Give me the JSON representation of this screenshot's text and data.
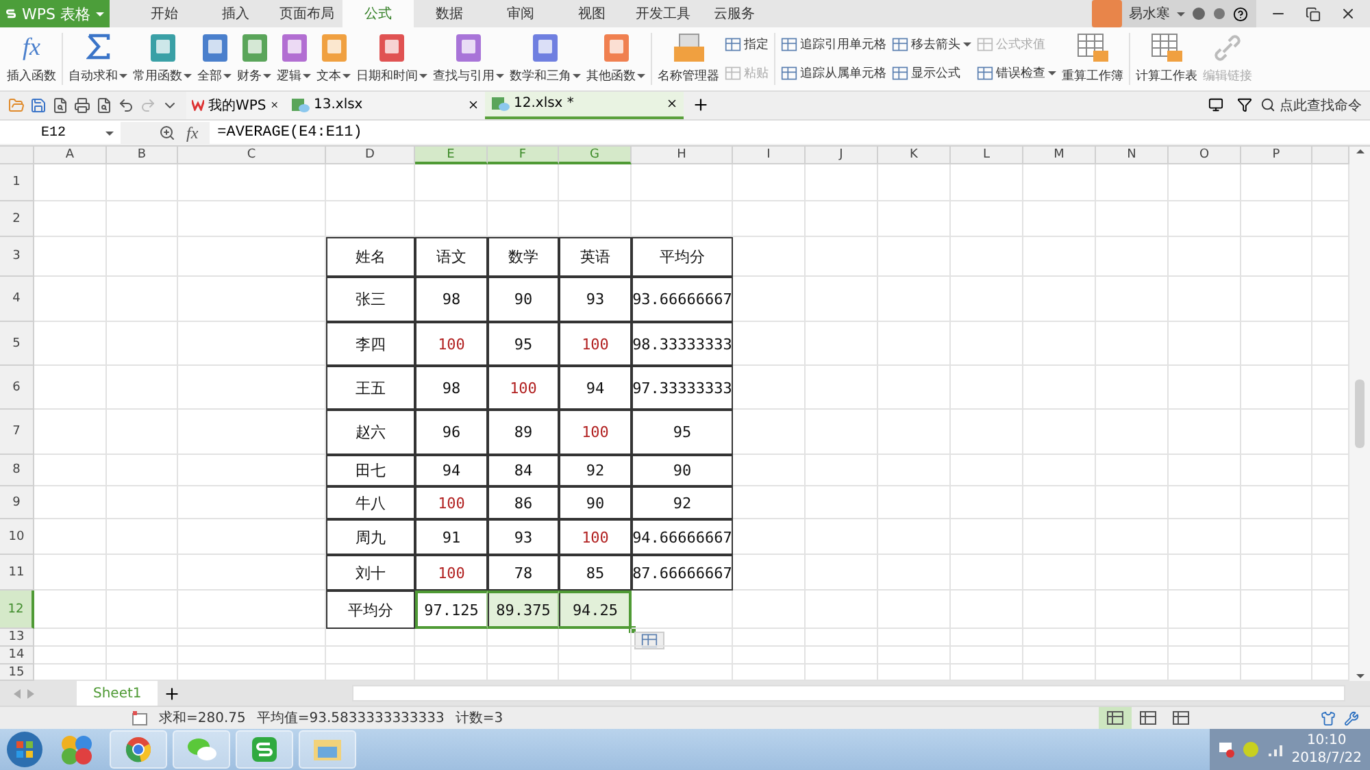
{
  "app_menu": {
    "label": "WPS 表格"
  },
  "menu_tabs": [
    {
      "label": "开始",
      "selected": false
    },
    {
      "label": "插入",
      "selected": false
    },
    {
      "label": "页面布局",
      "selected": false
    },
    {
      "label": "公式",
      "selected": true
    },
    {
      "label": "数据",
      "selected": false
    },
    {
      "label": "审阅",
      "selected": false
    },
    {
      "label": "视图",
      "selected": false
    },
    {
      "label": "开发工具",
      "selected": false
    },
    {
      "label": "云服务",
      "selected": false
    }
  ],
  "user": {
    "name": "易水寒"
  },
  "ribbon": [
    {
      "kind": "fx",
      "icon_text": "fx",
      "label": "插入函数",
      "dropdown": false,
      "disabled": false
    },
    {
      "kind": "sum",
      "label": "自动求和",
      "dropdown": true,
      "disabled": false
    },
    {
      "kind": "book",
      "label": "常用函数",
      "color": "#3aa0a6",
      "dropdown": true,
      "disabled": false
    },
    {
      "kind": "book",
      "label": "全部",
      "color": "#4a7fcc",
      "dropdown": true,
      "disabled": false
    },
    {
      "kind": "book",
      "label": "财务",
      "color": "#5aa55a",
      "dropdown": true,
      "disabled": false
    },
    {
      "kind": "book",
      "label": "逻辑",
      "color": "#b26ed2",
      "dropdown": true,
      "disabled": false
    },
    {
      "kind": "book",
      "label": "文本",
      "color": "#f0a040",
      "dropdown": true,
      "disabled": false
    },
    {
      "kind": "book",
      "label": "日期和时间",
      "color": "#e05252",
      "dropdown": true,
      "disabled": false
    },
    {
      "kind": "book",
      "label": "查找与引用",
      "color": "#a874d8",
      "dropdown": true,
      "disabled": false
    },
    {
      "kind": "book",
      "label": "数学和三角",
      "color": "#6f7fe0",
      "dropdown": true,
      "disabled": false
    },
    {
      "kind": "book",
      "label": "其他函数",
      "color": "#f08050",
      "dropdown": true,
      "disabled": false
    },
    {
      "kind": "manager",
      "label": "名称管理器",
      "dropdown": false,
      "disabled": false
    },
    {
      "kind": "stack",
      "items": [
        {
          "label": "指定",
          "dropdown": false,
          "disabled": false
        },
        {
          "label": "粘贴",
          "dropdown": false,
          "disabled": true
        }
      ]
    },
    {
      "kind": "stack",
      "items": [
        {
          "label": "追踪引用单元格",
          "dropdown": false,
          "disabled": false
        },
        {
          "label": "追踪从属单元格",
          "dropdown": false,
          "disabled": false
        }
      ]
    },
    {
      "kind": "stack",
      "items": [
        {
          "label": "移去箭头",
          "dropdown": true,
          "disabled": false
        },
        {
          "label": "显示公式",
          "dropdown": false,
          "disabled": false
        }
      ]
    },
    {
      "kind": "stack",
      "items": [
        {
          "label": "公式求值",
          "dropdown": false,
          "disabled": true
        },
        {
          "label": "错误检查",
          "dropdown": true,
          "disabled": false
        }
      ]
    },
    {
      "kind": "calc",
      "label": "重算工作簿",
      "dropdown": false,
      "disabled": false
    },
    {
      "kind": "calc",
      "label": "计算工作表",
      "dropdown": false,
      "disabled": false
    },
    {
      "kind": "link",
      "label": "编辑链接",
      "dropdown": false,
      "disabled": true
    }
  ],
  "doc_tabs": [
    {
      "kind": "home",
      "label": "我的WPS",
      "selected": false
    },
    {
      "kind": "file",
      "label": "13.xlsx",
      "selected": false
    },
    {
      "kind": "file",
      "label": "12.xlsx *",
      "selected": true
    }
  ],
  "command_search": {
    "placeholder": "点此查找命令"
  },
  "sheet": {
    "name_box": "E12",
    "fx_label": "fx",
    "formula": "=AVERAGE(E4:E11)",
    "columns": [
      {
        "label": "A",
        "selected": false
      },
      {
        "label": "B",
        "selected": false
      },
      {
        "label": "C",
        "selected": false
      },
      {
        "label": "D",
        "selected": false
      },
      {
        "label": "E",
        "selected": true
      },
      {
        "label": "F",
        "selected": true
      },
      {
        "label": "G",
        "selected": true
      },
      {
        "label": "H",
        "selected": false
      },
      {
        "label": "I",
        "selected": false
      },
      {
        "label": "J",
        "selected": false
      },
      {
        "label": "K",
        "selected": false
      },
      {
        "label": "L",
        "selected": false
      },
      {
        "label": "M",
        "selected": false
      },
      {
        "label": "N",
        "selected": false
      },
      {
        "label": "O",
        "selected": false
      },
      {
        "label": "P",
        "selected": false
      }
    ],
    "rows": [
      {
        "label": "1",
        "selected": false
      },
      {
        "label": "2",
        "selected": false
      },
      {
        "label": "3",
        "selected": false,
        "cells": [
          {
            "text": "姓名",
            "highlighted": false,
            "selected": false
          },
          {
            "text": "语文",
            "highlighted": false,
            "selected": false
          },
          {
            "text": "数学",
            "highlighted": false,
            "selected": false
          },
          {
            "text": "英语",
            "highlighted": false,
            "selected": false
          },
          {
            "text": "平均分",
            "highlighted": false,
            "selected": false
          }
        ]
      },
      {
        "label": "4",
        "selected": false,
        "cells": [
          {
            "text": "张三",
            "highlighted": false,
            "selected": false
          },
          {
            "text": "98",
            "highlighted": false,
            "selected": false
          },
          {
            "text": "90",
            "highlighted": false,
            "selected": false
          },
          {
            "text": "93",
            "highlighted": false,
            "selected": false
          },
          {
            "text": "93.66666667",
            "highlighted": false,
            "selected": false
          }
        ]
      },
      {
        "label": "5",
        "selected": false,
        "cells": [
          {
            "text": "李四",
            "highlighted": false,
            "selected": false
          },
          {
            "text": "100",
            "highlighted": true,
            "selected": false
          },
          {
            "text": "95",
            "highlighted": false,
            "selected": false
          },
          {
            "text": "100",
            "highlighted": true,
            "selected": false
          },
          {
            "text": "98.33333333",
            "highlighted": false,
            "selected": false
          }
        ]
      },
      {
        "label": "6",
        "selected": false,
        "cells": [
          {
            "text": "王五",
            "highlighted": false,
            "selected": false
          },
          {
            "text": "98",
            "highlighted": false,
            "selected": false
          },
          {
            "text": "100",
            "highlighted": true,
            "selected": false
          },
          {
            "text": "94",
            "highlighted": false,
            "selected": false
          },
          {
            "text": "97.33333333",
            "highlighted": false,
            "selected": false
          }
        ]
      },
      {
        "label": "7",
        "selected": false,
        "cells": [
          {
            "text": "赵六",
            "highlighted": false,
            "selected": false
          },
          {
            "text": "96",
            "highlighted": false,
            "selected": false
          },
          {
            "text": "89",
            "highlighted": false,
            "selected": false
          },
          {
            "text": "100",
            "highlighted": true,
            "selected": false
          },
          {
            "text": "95",
            "highlighted": false,
            "selected": false
          }
        ]
      },
      {
        "label": "8",
        "selected": false,
        "cells": [
          {
            "text": "田七",
            "highlighted": false,
            "selected": false
          },
          {
            "text": "94",
            "highlighted": false,
            "selected": false
          },
          {
            "text": "84",
            "highlighted": false,
            "selected": false
          },
          {
            "text": "92",
            "highlighted": false,
            "selected": false
          },
          {
            "text": "90",
            "highlighted": false,
            "selected": false
          }
        ]
      },
      {
        "label": "9",
        "selected": false,
        "cells": [
          {
            "text": "牛八",
            "highlighted": false,
            "selected": false
          },
          {
            "text": "100",
            "highlighted": true,
            "selected": false
          },
          {
            "text": "86",
            "highlighted": false,
            "selected": false
          },
          {
            "text": "90",
            "highlighted": false,
            "selected": false
          },
          {
            "text": "92",
            "highlighted": false,
            "selected": false
          }
        ]
      },
      {
        "label": "10",
        "selected": false,
        "cells": [
          {
            "text": "周九",
            "highlighted": false,
            "selected": false
          },
          {
            "text": "91",
            "highlighted": false,
            "selected": false
          },
          {
            "text": "93",
            "highlighted": false,
            "selected": false
          },
          {
            "text": "100",
            "highlighted": true,
            "selected": false
          },
          {
            "text": "94.66666667",
            "highlighted": false,
            "selected": false
          }
        ]
      },
      {
        "label": "11",
        "selected": false,
        "cells": [
          {
            "text": "刘十",
            "highlighted": false,
            "selected": false
          },
          {
            "text": "100",
            "highlighted": true,
            "selected": false
          },
          {
            "text": "78",
            "highlighted": false,
            "selected": false
          },
          {
            "text": "85",
            "highlighted": false,
            "selected": false
          },
          {
            "text": "87.66666667",
            "highlighted": false,
            "selected": false
          }
        ]
      },
      {
        "label": "12",
        "selected": true,
        "cells": [
          {
            "text": "平均分",
            "highlighted": false,
            "selected": false
          },
          {
            "text": "97.125",
            "highlighted": false,
            "selected": true
          },
          {
            "text": "89.375",
            "highlighted": false,
            "selected": true
          },
          {
            "text": "94.25",
            "highlighted": false,
            "selected": true
          }
        ]
      },
      {
        "label": "13",
        "selected": false
      },
      {
        "label": "14",
        "selected": false
      },
      {
        "label": "15",
        "selected": false
      }
    ]
  },
  "sheet_tabs": [
    {
      "label": "Sheet1",
      "selected": true
    }
  ],
  "status_bar": [
    "求和=280.75",
    "平均值=93.5833333333333",
    "计数=3"
  ],
  "taskbar": {
    "time": "10:10",
    "date": "2018/7/22"
  }
}
